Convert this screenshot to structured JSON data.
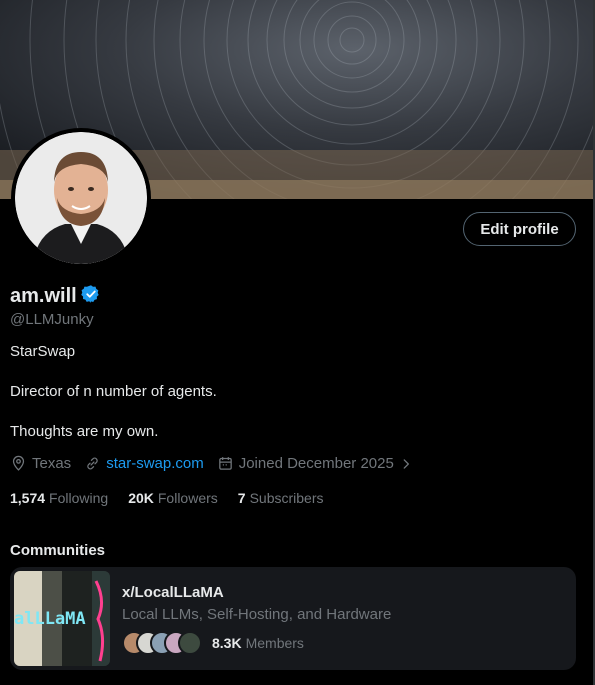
{
  "profile": {
    "name": "am.will",
    "handle": "@LLMJunky",
    "edit_button_label": "Edit profile",
    "bio": [
      "StarSwap",
      "Director of n number of agents.",
      "Thoughts are my own."
    ],
    "location": "Texas",
    "website": "star-swap.com",
    "joined": "Joined December 2025"
  },
  "stats": {
    "following_count": "1,574",
    "following_label": "Following",
    "followers_count": "20K",
    "followers_label": "Followers",
    "subscribers_count": "7",
    "subscribers_label": "Subscribers"
  },
  "communities": {
    "title": "Communities",
    "items": [
      {
        "name": "x/LocalLLaMA",
        "description": "Local LLMs, Self-Hosting, and Hardware",
        "thumb_text": "alLLaMA",
        "members_count": "8.3K",
        "members_label": "Members"
      }
    ]
  },
  "colors": {
    "background": "#000000",
    "accent": "#1d9bf0",
    "muted_text": "#71767b",
    "primary_text": "#e7e9ea",
    "card_bg": "#16181c"
  },
  "icons": [
    "verified-badge-icon",
    "location-pin-icon",
    "link-icon",
    "calendar-icon",
    "chevron-right-icon"
  ]
}
